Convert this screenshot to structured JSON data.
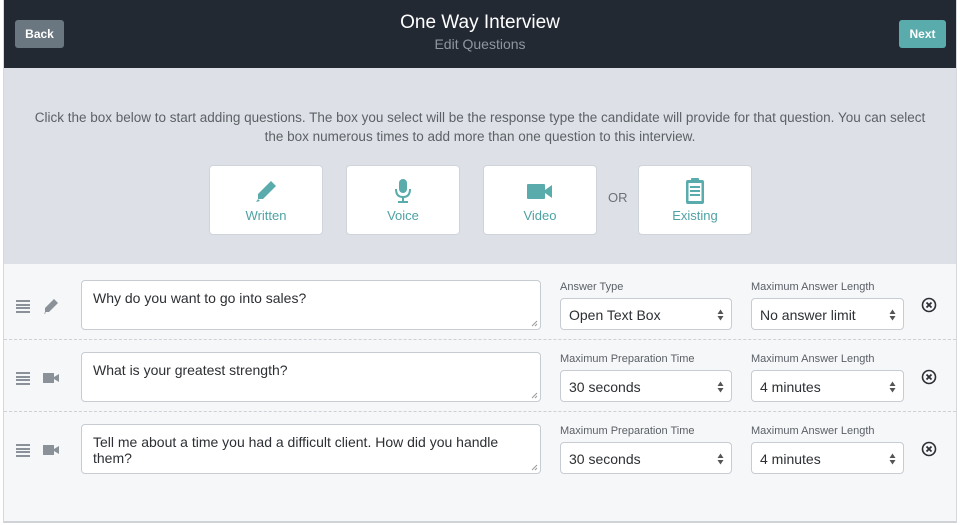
{
  "header": {
    "title": "One Way Interview",
    "subtitle": "Edit Questions",
    "back_label": "Back",
    "next_label": "Next"
  },
  "colors": {
    "accent": "#5aabac",
    "header_bg": "#232933",
    "back_button": "#6b7780"
  },
  "picker": {
    "instructions": "Click the box below to start adding questions. The box you select will be the response type the candidate will provide for that question. You can select the box numerous times to add more than one question to this interview.",
    "or_label": "OR",
    "types": [
      {
        "label": "Written",
        "icon": "pencil-icon"
      },
      {
        "label": "Voice",
        "icon": "microphone-icon"
      },
      {
        "label": "Video",
        "icon": "video-camera-icon"
      },
      {
        "label": "Existing",
        "icon": "clipboard-list-icon"
      }
    ]
  },
  "questions": [
    {
      "type_icon": "pencil-icon",
      "text": "Why do you want to go into sales?",
      "field1_label": "Answer Type",
      "field1_value": "Open Text Box",
      "field2_label": "Maximum Answer Length",
      "field2_value": "No answer limit"
    },
    {
      "type_icon": "video-camera-icon",
      "text": "What is your greatest strength?",
      "field1_label": "Maximum Preparation Time",
      "field1_value": "30 seconds",
      "field2_label": "Maximum Answer Length",
      "field2_value": "4 minutes"
    },
    {
      "type_icon": "video-camera-icon",
      "text": "Tell me about a time you had a difficult client. How did you handle them?",
      "field1_label": "Maximum Preparation Time",
      "field1_value": "30 seconds",
      "field2_label": "Maximum Answer Length",
      "field2_value": "4 minutes"
    }
  ]
}
